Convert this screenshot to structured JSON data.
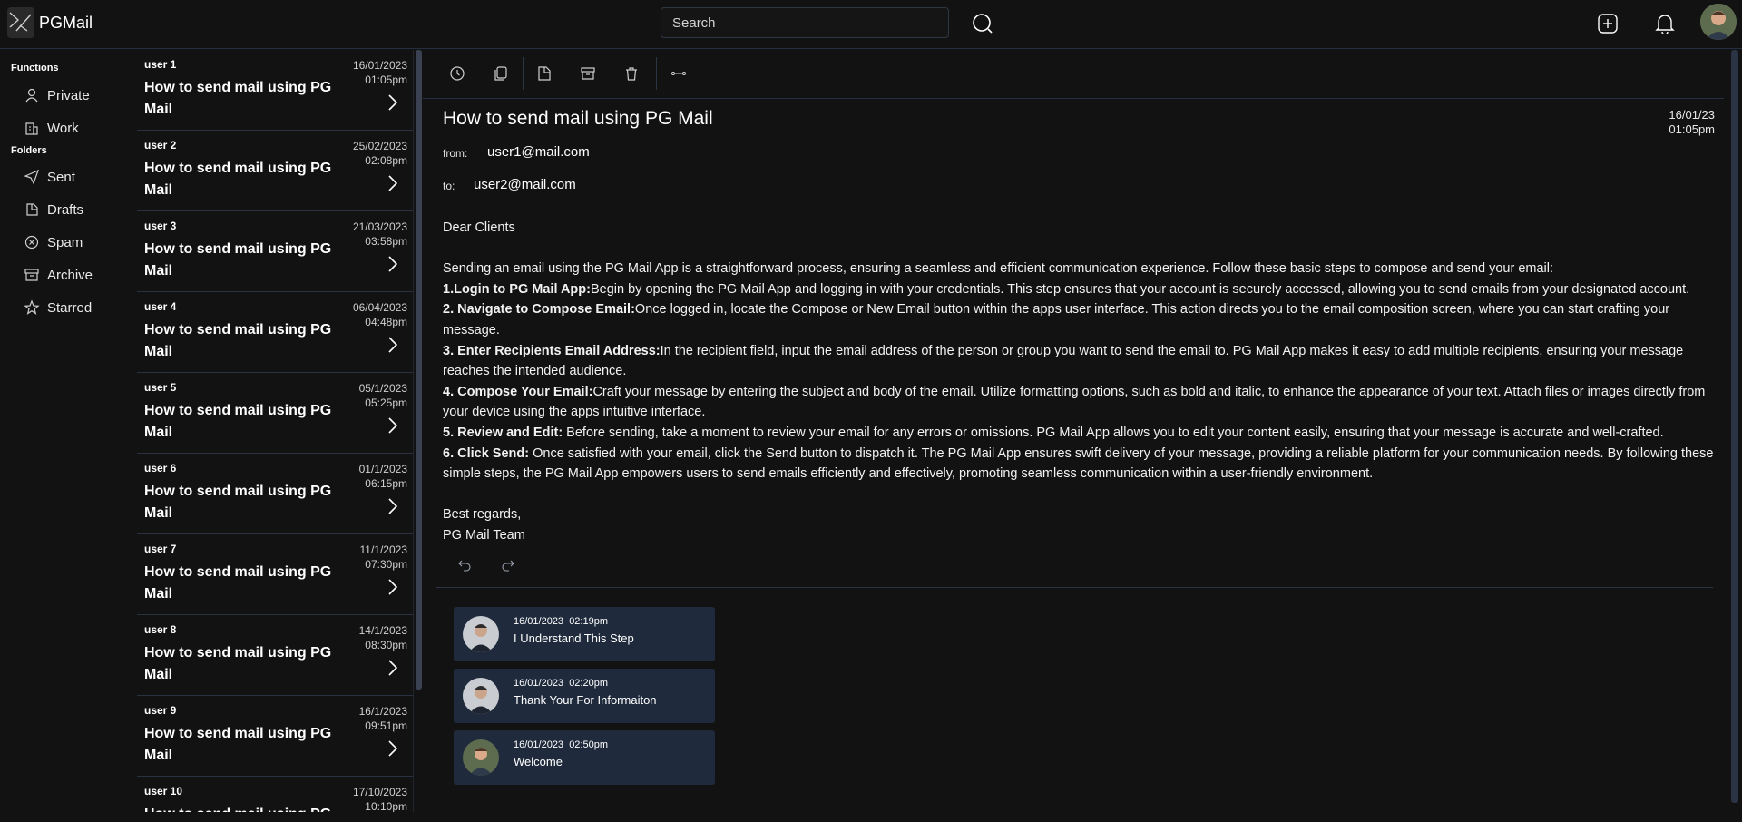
{
  "app": {
    "title": "PGMail"
  },
  "search": {
    "placeholder": "Search"
  },
  "nav": {
    "functions_heading": "Functions",
    "folders_heading": "Folders",
    "functions": [
      {
        "label": "Private",
        "icon": "user-icon"
      },
      {
        "label": "Work",
        "icon": "building-icon"
      }
    ],
    "folders": [
      {
        "label": "Sent",
        "icon": "send-icon"
      },
      {
        "label": "Drafts",
        "icon": "drafts-icon"
      },
      {
        "label": "Spam",
        "icon": "spam-icon"
      },
      {
        "label": "Archive",
        "icon": "archive-icon"
      },
      {
        "label": "Starred",
        "icon": "star-icon"
      }
    ]
  },
  "mail_list": [
    {
      "user": "user 1",
      "date": "16/01/2023",
      "time": "01:05pm",
      "subject": "How to send mail using PG Mail"
    },
    {
      "user": "user 2",
      "date": "25/02/2023",
      "time": "02:08pm",
      "subject": "How to send mail using PG Mail"
    },
    {
      "user": "user 3",
      "date": "21/03/2023",
      "time": "03:58pm",
      "subject": "How to send mail using PG Mail"
    },
    {
      "user": "user 4",
      "date": "06/04/2023",
      "time": "04:48pm",
      "subject": "How to send mail using PG Mail"
    },
    {
      "user": "user 5",
      "date": "05/1/2023",
      "time": "05:25pm",
      "subject": "How to send mail using PG Mail"
    },
    {
      "user": "user 6",
      "date": "01/1/2023",
      "time": "06:15pm",
      "subject": "How to send mail using PG Mail"
    },
    {
      "user": "user 7",
      "date": "11/1/2023",
      "time": "07:30pm",
      "subject": "How to send mail using PG Mail"
    },
    {
      "user": "user 8",
      "date": "14/1/2023",
      "time": "08:30pm",
      "subject": "How to send mail using PG Mail"
    },
    {
      "user": "user 9",
      "date": "16/1/2023",
      "time": "09:51pm",
      "subject": "How to send mail using PG Mail"
    },
    {
      "user": "user 10",
      "date": "17/10/2023",
      "time": "10:10pm",
      "subject": "How to send mail using PG Mail"
    }
  ],
  "mail": {
    "subject": "How to send mail using PG Mail",
    "date": "16/01/23",
    "time": "01:05pm",
    "from_label": "from:",
    "from": "user1@mail.com",
    "to_label": "to:",
    "to": "user2@mail.com",
    "greeting": "Dear Clients",
    "intro": "Sending an email using the PG Mail App is a straightforward process, ensuring a seamless and efficient communication experience. Follow these basic steps to compose and send your email:",
    "steps": [
      {
        "title": "1.Login to PG Mail App:",
        "text": "Begin by opening the PG Mail App and logging in with your credentials. This step ensures that your account is securely accessed, allowing you to send emails from your designated account."
      },
      {
        "title": "2. Navigate to Compose Email:",
        "text": "Once logged in, locate the Compose or New Email button within the apps user interface. This action directs you to the email composition screen, where you can start crafting your message."
      },
      {
        "title": "3. Enter Recipients Email Address:",
        "text": "In the recipient field, input the email address of the person or group you want to send the email to. PG Mail App makes it easy to add multiple recipients, ensuring your message reaches the intended audience."
      },
      {
        "title": "4. Compose Your Email:",
        "text": "Craft your message by entering the subject and body of the email. Utilize formatting options, such as bold and italic, to enhance the appearance of your text. Attach files or images directly from your device using the apps intuitive interface."
      },
      {
        "title": "5. Review and Edit:",
        "text": " Before sending, take a moment to review your email for any errors or omissions. PG Mail App allows you to edit your content easily, ensuring that your message is accurate and well-crafted."
      },
      {
        "title": "6. Click Send:",
        "text": " Once satisfied with your email, click the Send button to dispatch it. The PG Mail App ensures swift delivery of your message, providing a reliable platform for your communication needs. By following these simple steps, the PG Mail App empowers users to send emails efficiently and effectively, promoting seamless communication within a user-friendly environment."
      }
    ],
    "signoff": "Best regards,",
    "signature": "PG Mail Team"
  },
  "replies": [
    {
      "date": "16/01/2023",
      "time": "02:19pm",
      "text": "I Understand This Step"
    },
    {
      "date": "16/01/2023",
      "time": "02:20pm",
      "text": "Thank Your For Informaiton"
    },
    {
      "date": "16/01/2023",
      "time": "02:50pm",
      "text": "Welcome"
    }
  ],
  "colors": {
    "background": "#121212",
    "card": "#1f2a3c",
    "divider": "#2a3444"
  }
}
